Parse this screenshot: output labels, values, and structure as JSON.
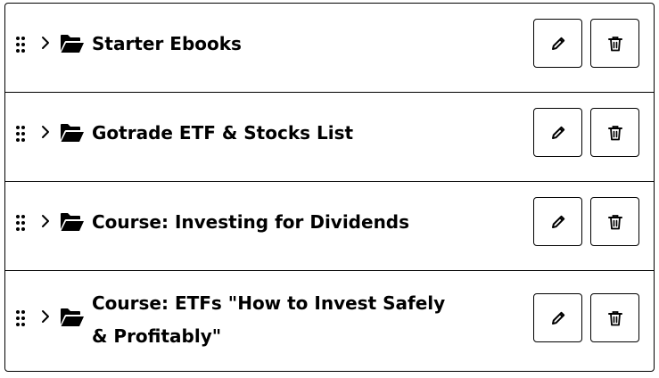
{
  "colors": {
    "border": "#000000",
    "background": "#ffffff",
    "text": "#000000"
  },
  "icons": {
    "drag": "drag-handle-icon",
    "expand": "chevron-right-icon",
    "folder": "folder-open-icon",
    "edit": "pencil-icon",
    "delete": "trash-icon"
  },
  "folders": [
    {
      "title": "Starter Ebooks"
    },
    {
      "title": "Gotrade ETF & Stocks List"
    },
    {
      "title": "Course: Investing for Dividends"
    },
    {
      "title": "Course: ETFs \"How to Invest Safely & Profitably\""
    }
  ]
}
